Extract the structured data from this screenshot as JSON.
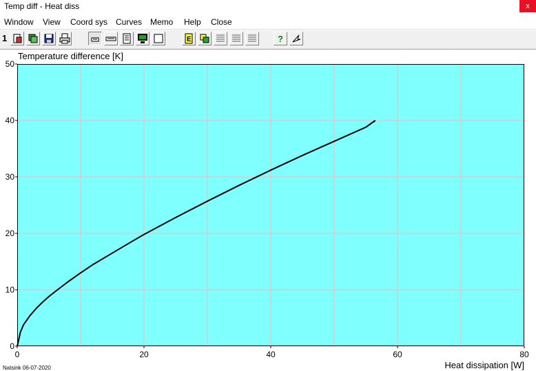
{
  "window": {
    "title": "Temp diff - Heat diss",
    "close_label": "x"
  },
  "menu": {
    "items": [
      "Window",
      "View",
      "Coord sys",
      "Curves",
      "Memo",
      "Help",
      "Close"
    ]
  },
  "toolbar": {
    "window_number": "1",
    "buttons": [
      "new-doc-icon",
      "copy-icon",
      "save-icon",
      "print-icon",
      "small-window-icon",
      "wide-window-icon",
      "page-icon",
      "monitor-icon",
      "blank-frame-icon",
      "e-icon",
      "paste-icon",
      "list-icon",
      "list-icon",
      "list-icon",
      "help-icon",
      "pointer-icon"
    ],
    "pressed_index": 4
  },
  "colors": {
    "plot_background": "#80ffff",
    "grid": "#ffb4b4",
    "curve": "#000000",
    "close_button": "#e81123"
  },
  "footer": {
    "note": "Natsink 06-07-2020"
  },
  "chart_data": {
    "type": "line",
    "ylabel": "Temperature difference [K]",
    "xlabel": "Heat dissipation [W]",
    "xlim": [
      0,
      80
    ],
    "ylim": [
      0,
      50
    ],
    "xticks": [
      "0",
      "20",
      "40",
      "60",
      "80"
    ],
    "yticks": [
      "0",
      "10",
      "20",
      "30",
      "40",
      "50"
    ],
    "grid": true,
    "series": [
      {
        "x": [
          0,
          0.5,
          1,
          2,
          3,
          4,
          5,
          6,
          8,
          10,
          12,
          15,
          18,
          20,
          25,
          30,
          35,
          40,
          45,
          50,
          55,
          56.5
        ],
        "y": [
          0,
          2.5,
          3.8,
          5.4,
          6.7,
          7.8,
          8.8,
          9.7,
          11.4,
          13.0,
          14.5,
          16.5,
          18.5,
          19.8,
          22.8,
          25.7,
          28.5,
          31.2,
          33.8,
          36.3,
          38.8,
          40.0
        ]
      }
    ]
  }
}
